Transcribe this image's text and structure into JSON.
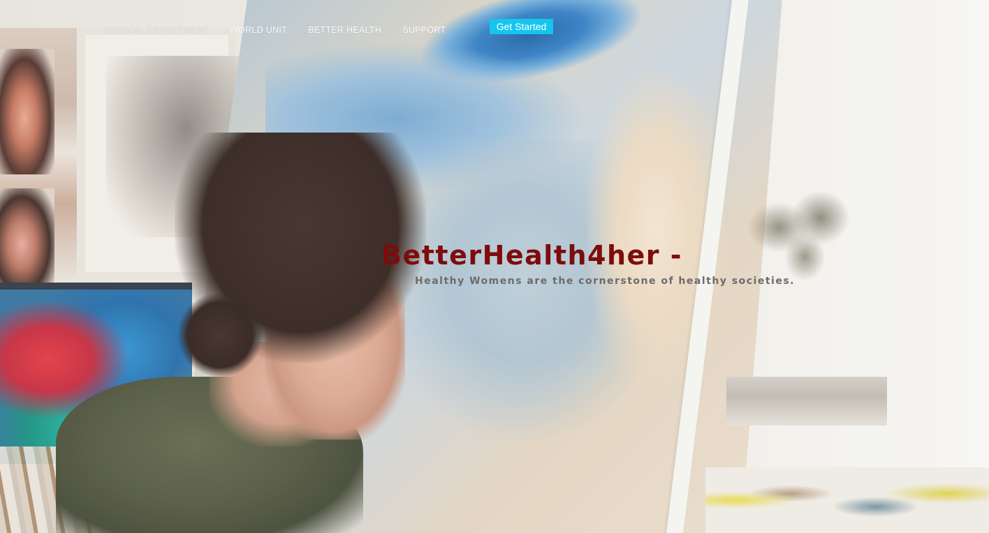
{
  "nav": {
    "items": [
      {
        "label": "MEDICAL DEPARTMENT"
      },
      {
        "label": "WORLD UNIT"
      },
      {
        "label": "BETTER HEALTH"
      },
      {
        "label": "SUPPORT"
      }
    ],
    "cta_label": "Get Started"
  },
  "hero": {
    "title": "BetterHealth4her -",
    "subtitle": "Healthy Womens are the cornerstone of healthy societies."
  },
  "colors": {
    "cta_background": "#14c6ee",
    "title_color": "#7e0c0c",
    "subtitle_color": "#6b6b6b"
  }
}
